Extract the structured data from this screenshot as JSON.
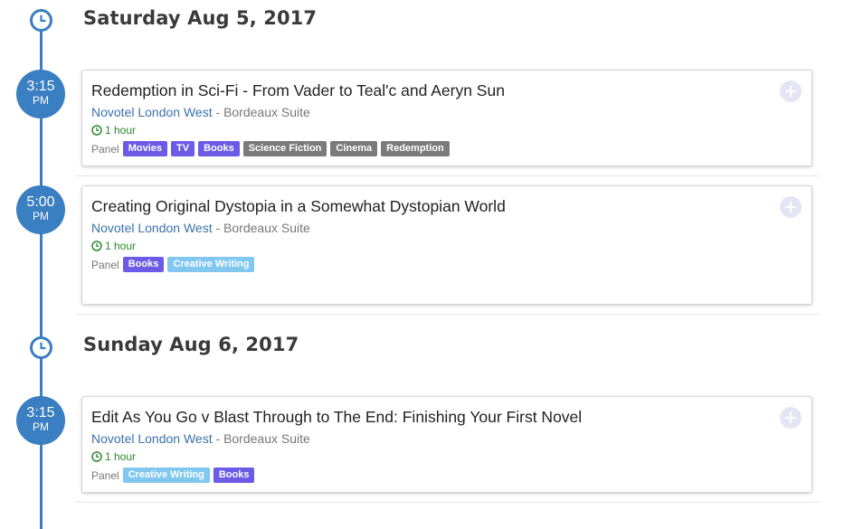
{
  "days": [
    {
      "heading": "Saturday Aug 5, 2017",
      "icon": "clock-icon",
      "events": [
        {
          "time": "3:15",
          "ampm": "PM",
          "title": "Redemption in Sci-Fi - From Vader to Teal'c and Aeryn Sun",
          "venue": "Novotel London West",
          "separator": " - ",
          "room": "Bordeaux Suite",
          "duration": "1 hour",
          "type": "Panel",
          "tags": [
            {
              "label": "Movies",
              "color": "#6b5be6"
            },
            {
              "label": "TV",
              "color": "#6b5be6"
            },
            {
              "label": "Books",
              "color": "#6b5be6"
            },
            {
              "label": "Science Fiction",
              "color": "#7b7b7b"
            },
            {
              "label": "Cinema",
              "color": "#7b7b7b"
            },
            {
              "label": "Redemption",
              "color": "#7b7b7b"
            }
          ]
        },
        {
          "time": "5:00",
          "ampm": "PM",
          "title": "Creating Original Dystopia in a Somewhat Dystopian World",
          "venue": "Novotel London West",
          "separator": " - ",
          "room": "Bordeaux Suite",
          "duration": "1 hour",
          "type": "Panel",
          "tags": [
            {
              "label": "Books",
              "color": "#6b5be6"
            },
            {
              "label": "Creative Writing",
              "color": "#80c8f0"
            }
          ]
        }
      ]
    },
    {
      "heading": "Sunday Aug 6, 2017",
      "icon": "clock-icon",
      "events": [
        {
          "time": "3:15",
          "ampm": "PM",
          "title": "Edit As You Go v Blast Through to The End: Finishing Your First Novel",
          "venue": "Novotel London West",
          "separator": " - ",
          "room": "Bordeaux Suite",
          "duration": "1 hour",
          "type": "Panel",
          "tags": [
            {
              "label": "Creative Writing",
              "color": "#80c8f0"
            },
            {
              "label": "Books",
              "color": "#6b5be6"
            }
          ]
        }
      ]
    }
  ],
  "colors": {
    "accent": "#3a7fc1",
    "venue_link": "#3a72ad",
    "duration": "#2e8b2e",
    "tag_purple": "#6b5be6",
    "tag_gray": "#7b7b7b",
    "tag_light": "#80c8f0"
  }
}
